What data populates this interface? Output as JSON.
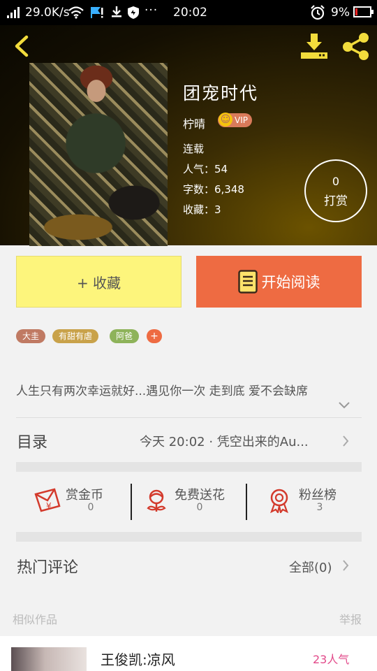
{
  "status_bar": {
    "speed": "29.0K/s",
    "time": "20:02",
    "battery": "9%",
    "notification_icons": [
      "wifi-icon",
      "flag-icon",
      "download-icon",
      "shield-icon",
      "more-icon"
    ]
  },
  "book": {
    "title": "团宠时代",
    "author": "柠晴",
    "vip_label": "VIP",
    "status": "连载",
    "popularity_label": "人气：54",
    "words_label": "字数：6,348",
    "favorites_label": "收藏：3",
    "tip_count": "0",
    "tip_label": "打赏"
  },
  "actions": {
    "favorite_label": "+ 收藏",
    "read_label": "开始阅读"
  },
  "tags": [
    {
      "label": "大圭",
      "color": "#c07a63"
    },
    {
      "label": "有甜有虐",
      "color": "#c9a24a"
    },
    {
      "label": "阿爸",
      "color": "#8eb35a"
    }
  ],
  "tag_add_label": "+",
  "intro": "人生只有两次幸运就好...遇见你一次 走到底 爱不会缺席",
  "catalog": {
    "label": "目录",
    "latest": "今天 20:02 · 凭空出来的Au..."
  },
  "stats": [
    {
      "label": "赏金币",
      "value": "0",
      "icon": "red-envelope-icon"
    },
    {
      "label": "免费送花",
      "value": "0",
      "icon": "flower-icon"
    },
    {
      "label": "粉丝榜",
      "value": "3",
      "icon": "medal-icon"
    }
  ],
  "comments": {
    "label": "热门评论",
    "all_label": "全部(0)"
  },
  "similar_label": "相似作品",
  "report_label": "举报",
  "similar_items": [
    {
      "title": "王俊凯:凉风",
      "popularity": "23人气"
    }
  ],
  "colors": {
    "accent_orange": "#ee6b42",
    "favorite_yellow": "#fdf57c",
    "icon_gold": "#f2dc3c",
    "stat_red": "#d33a2c",
    "popularity_pink": "#e24a8a"
  }
}
